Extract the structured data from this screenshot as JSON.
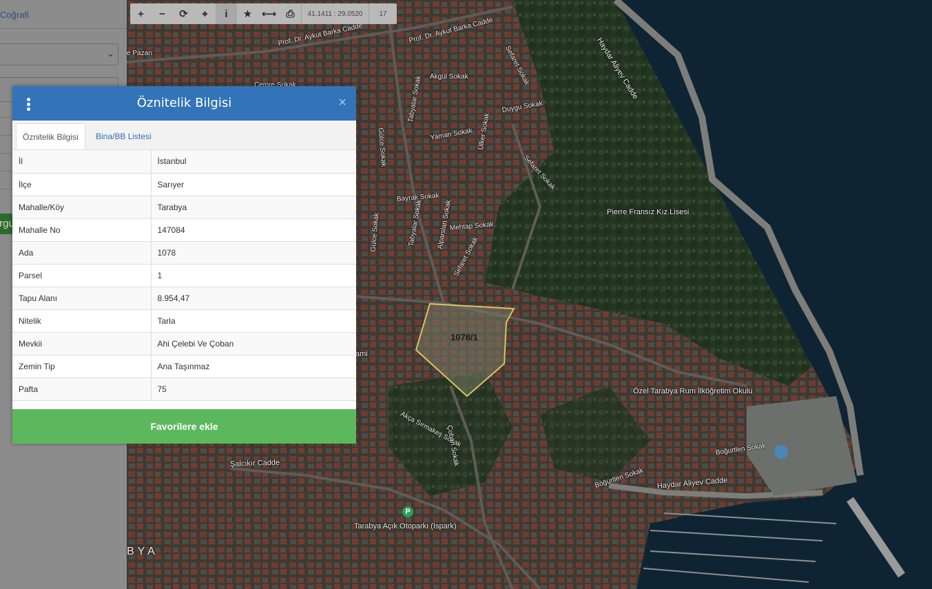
{
  "sidebar": {
    "link_label": "Coğrafi",
    "button_label": "rgu"
  },
  "toolbar": {
    "buttons": [
      {
        "icon": "zoom-in-icon",
        "glyph": "+"
      },
      {
        "icon": "zoom-out-icon",
        "glyph": "−"
      },
      {
        "icon": "refresh-icon",
        "glyph": "⟳"
      },
      {
        "icon": "locate-icon",
        "glyph": "⌖"
      },
      {
        "icon": "info-icon",
        "glyph": "i"
      },
      {
        "icon": "star-icon",
        "glyph": "★"
      },
      {
        "icon": "measure-icon",
        "glyph": "⟷"
      },
      {
        "icon": "print-icon",
        "glyph": "⎙"
      }
    ],
    "coordinates": "41.1411 : 29.0520",
    "zoom_level": "17"
  },
  "map": {
    "street_labels": [
      "Prof. Dr. Aykut Barka Cadde",
      "Prof. Dr. Aykut Barka Cadde",
      "Sefaret Sokak",
      "Haydar Aliyev Cadde",
      "Akgül Sokak",
      "Çemre Sokak",
      "Duygu Sokak",
      "Yaman Sokak",
      "Gülce Sokak",
      "Tabyalar Sokak",
      "Bayrak Sokak",
      "Mehtap Sokak",
      "Alparslan Sokak",
      "Sefaret Sokak",
      "Ülker Sokak",
      "Sefaret Sokak",
      "Gülce Sokak",
      "Tabyalar Sokak",
      "Akça Sırmakeş Sokak",
      "Çoban Sokak",
      "Şalcıkır Cadde",
      "Boğurtlen Sokak",
      "Böğürtlen Sokak",
      "Haydar Aliyev Cadde",
      "ami",
      "e Pazarı"
    ],
    "poi_labels": [
      "Pierre Fransız Kız Lisesi",
      "Özel Tarabya Rum İlköğretim Okulu",
      "Tarabya Açık Otoparkı (İspark)"
    ],
    "parking_badge": "P",
    "area_name": "BYA",
    "parcel_label": "1078/1"
  },
  "panel": {
    "title": "Öznitelik Bilgisi",
    "tabs": [
      "Öznitelik Bilgisi",
      "Bina/BB Listesi"
    ],
    "rows": [
      {
        "key": "İl",
        "value": "İstanbul"
      },
      {
        "key": "İlçe",
        "value": "Sarıyer"
      },
      {
        "key": "Mahalle/Köy",
        "value": "Tarabya"
      },
      {
        "key": "Mahalle No",
        "value": "147084"
      },
      {
        "key": "Ada",
        "value": "1078"
      },
      {
        "key": "Parsel",
        "value": "1"
      },
      {
        "key": "Tapu Alanı",
        "value": "8.954,47"
      },
      {
        "key": "Nitelik",
        "value": "Tarla"
      },
      {
        "key": "Mevkii",
        "value": "Ahi Çelebi Ve Çoban"
      },
      {
        "key": "Zemin Tip",
        "value": "Ana Taşınmaz"
      },
      {
        "key": "Pafta",
        "value": "75"
      }
    ],
    "favorite_button": "Favorilere ekle"
  },
  "colors": {
    "panel_header": "#3274b7",
    "favorite_button": "#5cb85c",
    "parcel_outline": "#d8c565",
    "sea": "#0f2433"
  }
}
